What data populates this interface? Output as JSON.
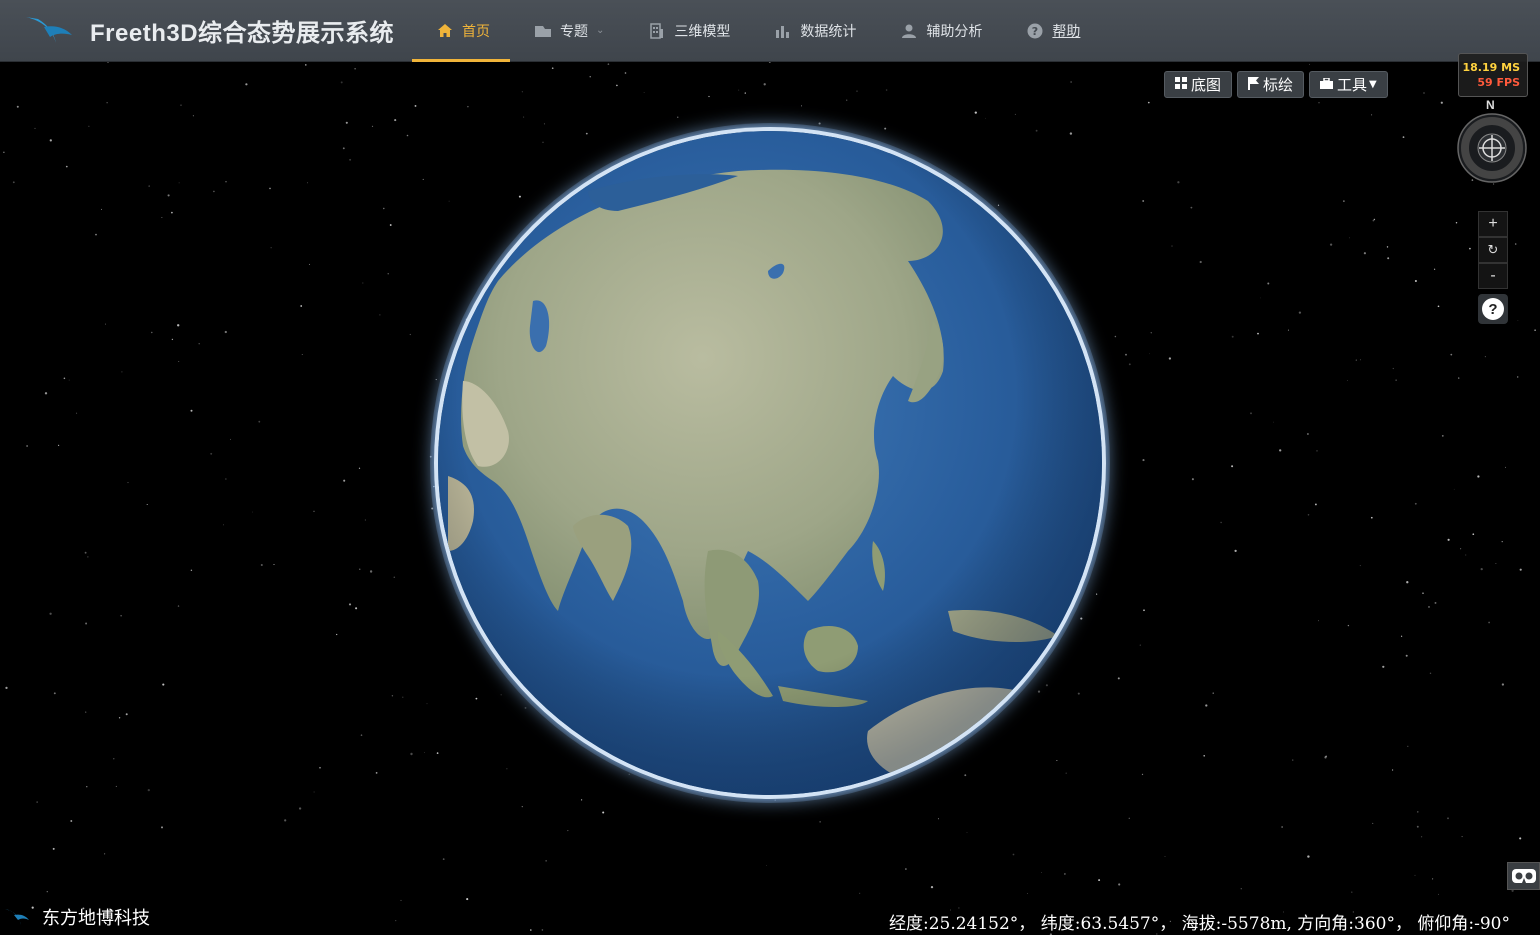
{
  "header": {
    "title": "Freeth3D综合态势展示系统",
    "logo_icon": "bird-logo-icon",
    "nav": [
      {
        "label": "首页",
        "icon": "home-icon",
        "active": true
      },
      {
        "label": "专题",
        "icon": "topic-icon",
        "has_dropdown": true
      },
      {
        "label": "三维模型",
        "icon": "building-icon"
      },
      {
        "label": "数据统计",
        "icon": "bar-chart-icon"
      },
      {
        "label": "辅助分析",
        "icon": "user-icon"
      },
      {
        "label": "帮助",
        "icon": "question-icon"
      }
    ]
  },
  "map_toolbar": {
    "basemap_label": "底图",
    "marker_label": "标绘",
    "tools_label": "工具"
  },
  "performance": {
    "ms": "18.19 MS",
    "fps": "59 FPS"
  },
  "compass": {
    "north_label": "N"
  },
  "zoom": {
    "zoom_in": "+",
    "reset": "↻",
    "zoom_out": "-",
    "help": "?"
  },
  "footer": {
    "company": "东方地博科技",
    "status": "经度:25.24152°， 纬度:63.5457°， 海拔:-5578m, 方向角:360°， 俯仰角:-90°"
  },
  "colors": {
    "accent": "#f0b43a",
    "topbar": "#454b52",
    "ocean": "#2a5f9e",
    "land": "#a9b192"
  }
}
